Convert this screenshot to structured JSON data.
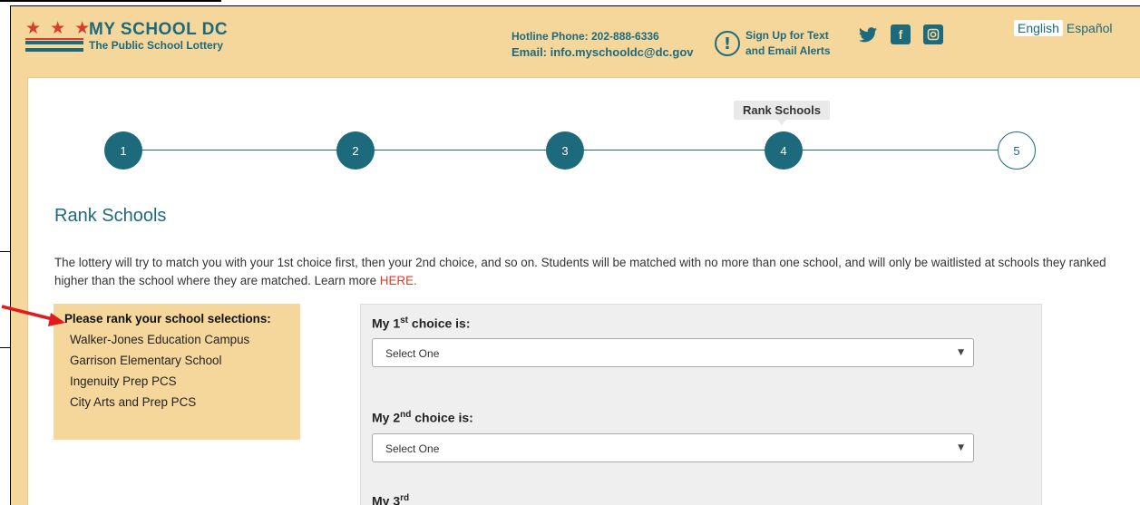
{
  "header": {
    "logo_stars": "★ ★ ★",
    "logo_title": "MY SCHOOL DC",
    "logo_subtitle": "The Public School Lottery",
    "hotline": "Hotline Phone: 202-888-6336",
    "email": "Email: info.myschooldc@dc.gov",
    "alert_line1": "Sign Up for Text",
    "alert_line2": "and Email Alerts",
    "lang_active": "English",
    "lang_other": "Español"
  },
  "progress": {
    "steps": [
      "1",
      "2",
      "3",
      "4",
      "5"
    ],
    "current_tooltip": "Rank Schools"
  },
  "page": {
    "title": "Rank Schools",
    "instructions": "The lottery will try to match you with your 1st choice first, then your 2nd choice, and so on. Students will be matched with no more than one school, and will only be waitlisted at schools they ranked higher than the school where they are matched. Learn more ",
    "learn_more_link": "HERE.",
    "rank_heading": "Please rank your school selections:",
    "schools": [
      "Walker-Jones Education Campus",
      "Garrison Elementary School",
      "Ingenuity Prep PCS",
      "City Arts and Prep PCS"
    ]
  },
  "choices": [
    {
      "prefix": "My 1",
      "sup": "st",
      "suffix": " choice is:",
      "value": "Select One"
    },
    {
      "prefix": "My 2",
      "sup": "nd",
      "suffix": " choice is:",
      "value": "Select One"
    },
    {
      "prefix": "My 3",
      "sup": "rd",
      "suffix": "",
      "value": ""
    }
  ],
  "colors": {
    "accent": "#1d6a7d",
    "banner": "#f5d79c",
    "link": "#d83c2e"
  }
}
